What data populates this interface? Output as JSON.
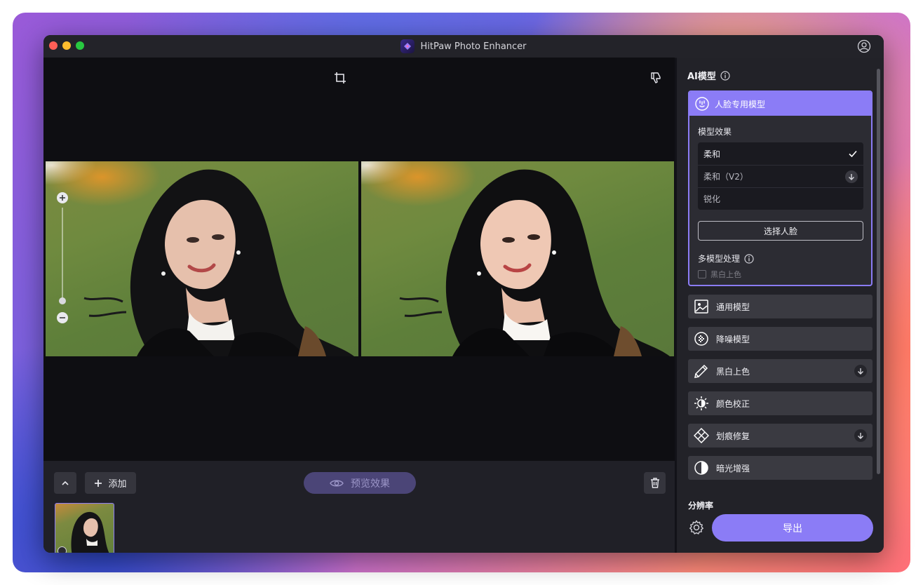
{
  "window": {
    "title": "HitPaw Photo Enhancer"
  },
  "toolbar": {
    "add_label": "添加",
    "preview_label": "预览效果"
  },
  "panel": {
    "title": "AI模型",
    "face_model": {
      "name": "人脸专用模型",
      "effect_label": "模型效果",
      "options": [
        {
          "label": "柔和",
          "selected": true
        },
        {
          "label": "柔和（V2）",
          "download": true
        },
        {
          "label": "锐化"
        }
      ],
      "select_face_label": "选择人脸",
      "multi_model_label": "多模型处理",
      "bw_colorize_option": "黑白上色"
    },
    "models": [
      {
        "name": "通用模型",
        "icon": "general-model-icon"
      },
      {
        "name": "降噪模型",
        "icon": "denoise-model-icon"
      },
      {
        "name": "黑白上色",
        "icon": "colorize-icon",
        "download": true
      },
      {
        "name": "颜色校正",
        "icon": "color-correct-icon"
      },
      {
        "name": "划痕修复",
        "icon": "scratch-repair-icon",
        "download": true
      },
      {
        "name": "暗光增强",
        "icon": "low-light-icon"
      }
    ],
    "resolution_label": "分辨率",
    "export_label": "导出"
  },
  "colors": {
    "accent": "#8b7cf6",
    "panel_bg": "#222228",
    "canvas_bg": "#0e0e12"
  }
}
